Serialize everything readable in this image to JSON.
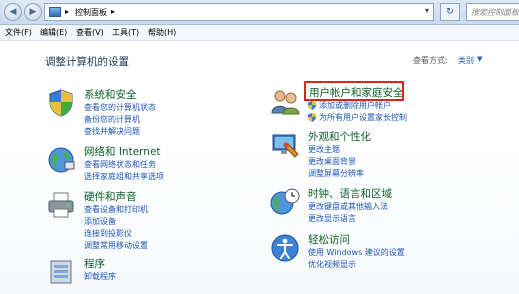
{
  "address_bar": {
    "breadcrumbs": [
      "控制面板"
    ],
    "search_placeholder": "搜索控制面板"
  },
  "menu": [
    "文件(F)",
    "编辑(E)",
    "查看(V)",
    "工具(T)",
    "帮助(H)"
  ],
  "main": {
    "title": "调整计算机的设置",
    "view_by_label": "查看方式:",
    "view_by_value": "类别"
  },
  "categories": [
    {
      "name": "系统和安全",
      "links": [
        "查看您的计算机状态",
        "备份您的计算机",
        "查找并解决问题"
      ]
    },
    {
      "name": "网络和 Internet",
      "links": [
        "查看网络状态和任务",
        "选择家庭组和共享选项"
      ]
    },
    {
      "name": "硬件和声音",
      "links": [
        "查看设备和打印机",
        "添加设备",
        "连接到投影仪",
        "调整常用移动设置"
      ]
    },
    {
      "name": "程序",
      "links": [
        "卸载程序"
      ]
    },
    {
      "name": "用户帐户和家庭安全",
      "links": [
        "添加或删除用户帐户",
        "为所有用户设置家长控制"
      ]
    },
    {
      "name": "外观和个性化",
      "links": [
        "更改主题",
        "更改桌面背景",
        "调整屏幕分辨率"
      ]
    },
    {
      "name": "时钟、语言和区域",
      "links": [
        "更改键盘或其他输入法",
        "更改显示语言"
      ]
    },
    {
      "name": "轻松访问",
      "links": [
        "使用 Windows 建议的设置",
        "优化视频显示"
      ]
    }
  ],
  "colors": {
    "category_heading": "#0a5f29",
    "link": "#1c56b6",
    "highlight_box": "#e2231a"
  }
}
